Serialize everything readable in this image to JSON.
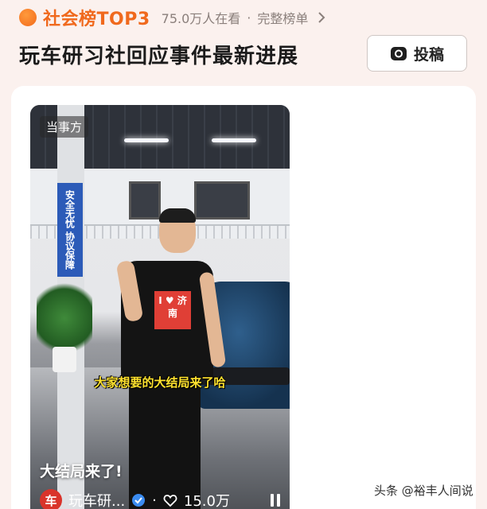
{
  "header": {
    "rank_title": "社会榜TOP3",
    "watch_count": "75.0万人在看",
    "separator": "·",
    "full_list_link": "完整榜单",
    "headline": "玩车研习社回应事件最新进展",
    "submit_button": "投稿"
  },
  "video": {
    "party_tag": "当事方",
    "subtitle": "大家想要的大结局来了哈",
    "caption": "大结局来了!",
    "author_avatar_text": "车",
    "author_name": "玩车研...",
    "like_count": "15.0万",
    "shirt_text": "I ♥ 济南",
    "banner_text": "安全无忧 协议保障"
  },
  "watermark": "头条 @裕丰人间说",
  "icons": {
    "rank": "flame-icon",
    "chevron": "chevron-right-icon",
    "submit": "camera-icon",
    "verified": "verified-icon",
    "like": "heart-icon",
    "pause": "pause-icon"
  },
  "colors": {
    "accent_orange": "#f0691d",
    "background": "#fbf1ee",
    "subtitle_yellow": "#ffe22e",
    "verified_blue": "#3a8bf0"
  }
}
